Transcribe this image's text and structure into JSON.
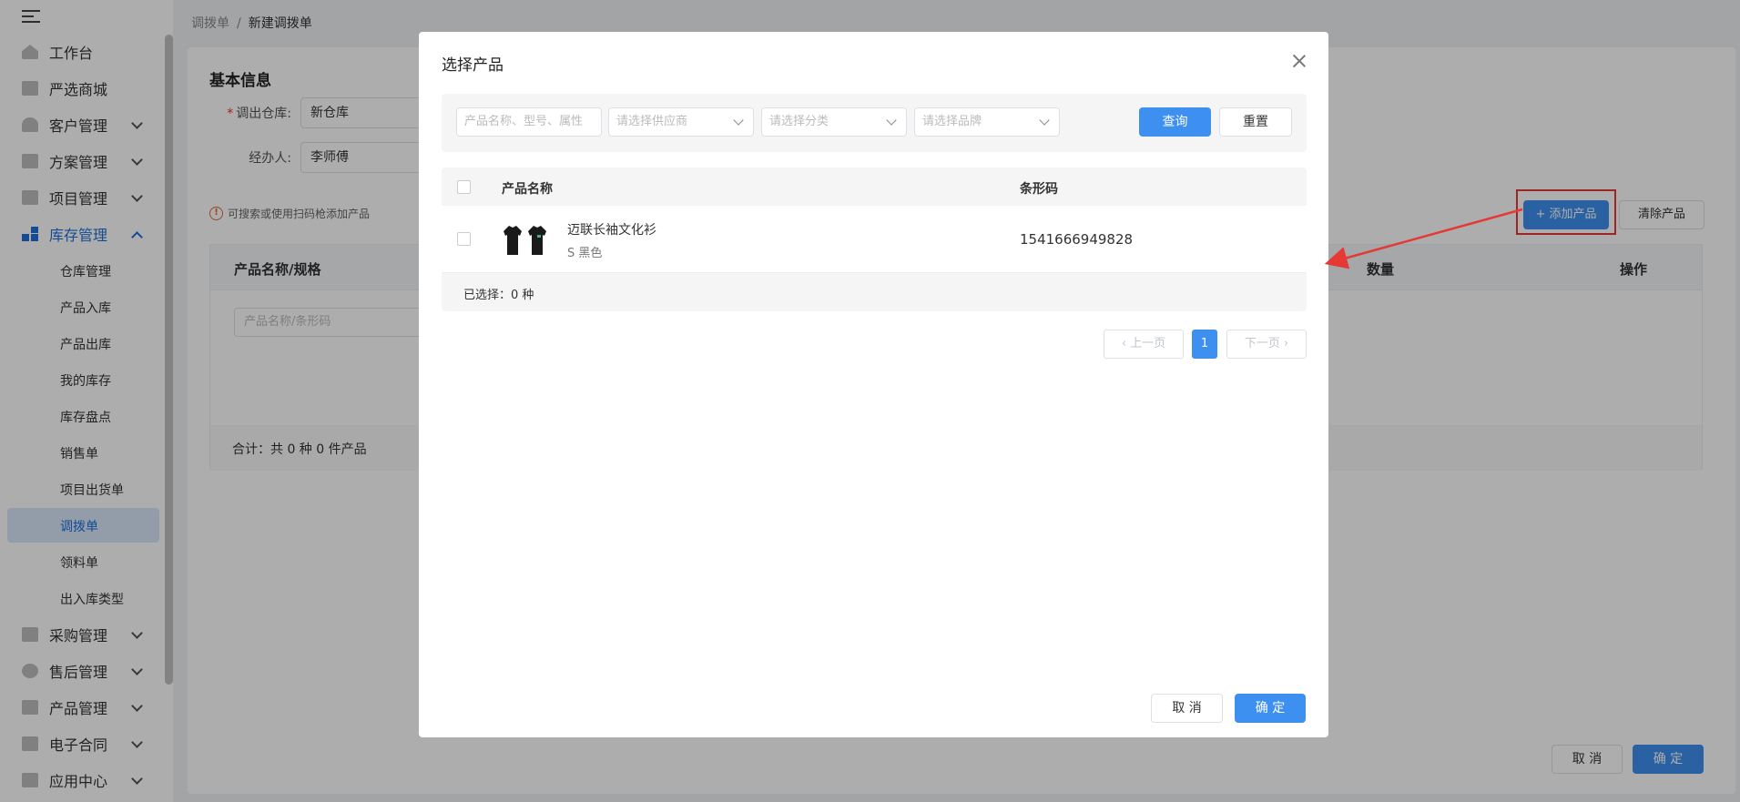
{
  "breadcrumb": {
    "parent": "调拨单",
    "current": "新建调拨单"
  },
  "sidebar": {
    "items": [
      {
        "label": "工作台",
        "icon": "home-icon"
      },
      {
        "label": "严选商城",
        "icon": "mall-icon"
      },
      {
        "label": "客户管理",
        "icon": "customer-icon"
      },
      {
        "label": "方案管理",
        "icon": "plan-icon"
      },
      {
        "label": "项目管理",
        "icon": "folder-icon"
      },
      {
        "label": "库存管理",
        "icon": "inventory-icon"
      },
      {
        "label": "采购管理",
        "icon": "cart-icon"
      },
      {
        "label": "售后管理",
        "icon": "headset-icon"
      },
      {
        "label": "产品管理",
        "icon": "product-icon"
      },
      {
        "label": "电子合同",
        "icon": "contract-icon"
      },
      {
        "label": "应用中心",
        "icon": "apps-icon"
      }
    ],
    "sub_items": [
      "仓库管理",
      "产品入库",
      "产品出库",
      "我的库存",
      "库存盘点",
      "销售单",
      "项目出货单",
      "调拨单",
      "领料单",
      "出入库类型"
    ]
  },
  "form": {
    "section_title": "基本信息",
    "out_warehouse_label": "调出仓库:",
    "out_warehouse_value": "新仓库",
    "handler_label": "经办人:",
    "handler_value": "李师傅",
    "tip": "可搜索或使用扫码枪添加产品"
  },
  "product_table": {
    "col_name": "产品名称/规格",
    "col_qty": "数量",
    "col_action": "操作",
    "search_placeholder": "产品名称/条形码",
    "summary": "合计：共 0 种 0 件产品"
  },
  "buttons": {
    "add_product": "+ 添加产品",
    "clear_product": "清除产品",
    "cancel": "取 消",
    "confirm": "确 定"
  },
  "modal": {
    "title": "选择产品",
    "search_placeholder": "产品名称、型号、属性",
    "supplier_placeholder": "请选择供应商",
    "category_placeholder": "请选择分类",
    "brand_placeholder": "请选择品牌",
    "query_btn": "查询",
    "reset_btn": "重置",
    "col_name": "产品名称",
    "col_barcode": "条形码",
    "rows": [
      {
        "name": "迈联长袖文化衫",
        "spec": "S 黑色",
        "barcode": "1541666949828"
      }
    ],
    "selected_text": "已选择：0 种",
    "prev_page": "上一页",
    "next_page": "下一页",
    "current_page": "1",
    "cancel_btn": "取 消",
    "confirm_btn": "确 定"
  }
}
